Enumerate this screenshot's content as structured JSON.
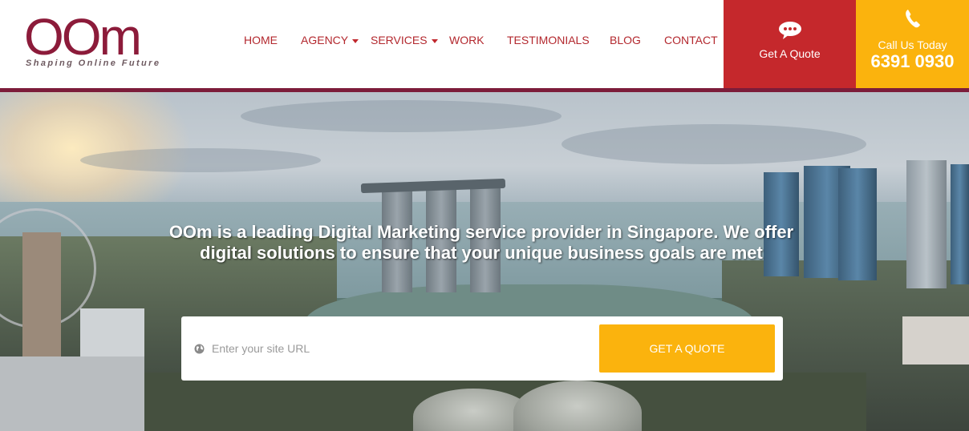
{
  "logo": {
    "text": "OOm",
    "tagline": "Shaping Online Future"
  },
  "nav": [
    {
      "label": "HOME",
      "has_dropdown": false
    },
    {
      "label": "AGENCY",
      "has_dropdown": true
    },
    {
      "label": "SERVICES",
      "has_dropdown": true
    },
    {
      "label": "WORK",
      "has_dropdown": false
    },
    {
      "label": "TESTIMONIALS",
      "has_dropdown": false
    },
    {
      "label": "BLOG",
      "has_dropdown": false
    },
    {
      "label": "CONTACT",
      "has_dropdown": false
    }
  ],
  "quote_box": {
    "label": "Get A Quote",
    "icon": "chat-bubble-icon",
    "color": "#c5282c"
  },
  "call_box": {
    "label": "Call Us Today",
    "number": "6391 0930",
    "icon": "phone-icon",
    "color": "#fbb30d"
  },
  "hero": {
    "headline": "OOm is a leading Digital Marketing service provider in Singapore. We offer digital solutions to ensure that your unique business goals are met",
    "input_placeholder": "Enter your site URL",
    "input_value": "",
    "button_label": "GET A QUOTE"
  },
  "colors": {
    "brand": "#8c1b3a",
    "nav_text": "#b3282e",
    "accent": "#fbb30d"
  }
}
